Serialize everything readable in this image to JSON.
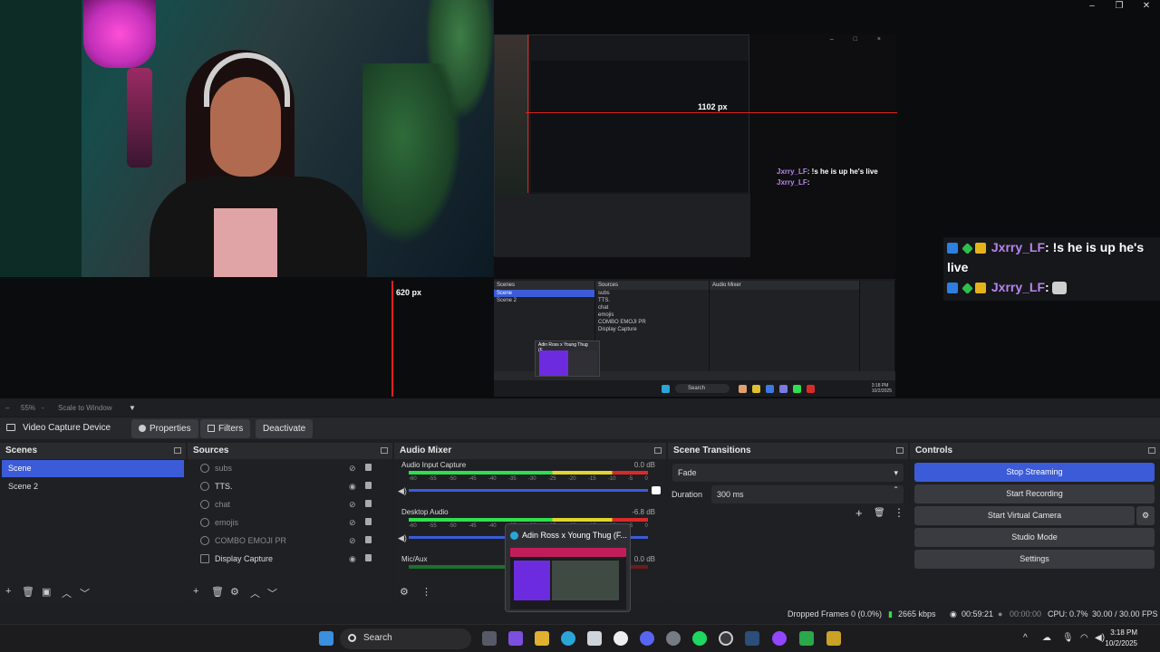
{
  "preview": {
    "nested_px_width": "1102 px",
    "nested_px_height": "620 px",
    "chat_small": [
      {
        "name": "Jxrry_LF",
        "text": ": !s he is up he's live"
      },
      {
        "name": "Jxrry_LF",
        "text": ":"
      }
    ]
  },
  "chat": {
    "line1_name": "Jxrry_LF",
    "line1_text": ": !s he is up he's",
    "line1_cont": "live",
    "line2_name": "Jxrry_LF",
    "line2_text": ":"
  },
  "zoom": {
    "value": "55%",
    "scale_label": "Scale to Window"
  },
  "source_toolbar": {
    "source_name": "Video Capture Device",
    "properties": "Properties",
    "filters": "Filters",
    "deactivate": "Deactivate"
  },
  "scenes": {
    "title": "Scenes",
    "items": [
      "Scene",
      "Scene 2"
    ]
  },
  "sources": {
    "title": "Sources",
    "items": [
      "subs",
      "TTS.",
      "chat",
      "emojis",
      "COMBO EMOJI PR",
      "Display Capture"
    ]
  },
  "mixer": {
    "title": "Audio Mixer",
    "channels": [
      {
        "name": "Audio Input Capture",
        "db": "0.0 dB"
      },
      {
        "name": "Desktop Audio",
        "db": "-6.8 dB"
      },
      {
        "name": "Mic/Aux",
        "db": "0.0 dB"
      }
    ],
    "ticks": [
      "-60",
      "-55",
      "-50",
      "-45",
      "-40",
      "-35",
      "-30",
      "-25",
      "-20",
      "-15",
      "-10",
      "-5",
      "0"
    ]
  },
  "transitions": {
    "title": "Scene Transitions",
    "selected": "Fade",
    "duration_label": "Duration",
    "duration_value": "300 ms"
  },
  "controls": {
    "title": "Controls",
    "stop_streaming": "Stop Streaming",
    "start_recording": "Start Recording",
    "start_virtual_camera": "Start Virtual Camera",
    "studio_mode": "Studio Mode",
    "settings": "Settings"
  },
  "popup": {
    "title": "Adin Ross x Young Thug (F..."
  },
  "status": {
    "dropped": "Dropped Frames 0 (0.0%)",
    "bitrate": "2665 kbps",
    "stream_time": "00:59:21",
    "rec_time": "00:00:00",
    "cpu": "CPU: 0.7%",
    "fps": "30.00 / 30.00 FPS"
  },
  "taskbar": {
    "search": "Search",
    "time": "3:18 PM",
    "date": "10/2/2025"
  },
  "colors": {
    "accent": "#3b5bd9",
    "chat_name": "#b784f0",
    "meter_green": "#2ee04d"
  }
}
